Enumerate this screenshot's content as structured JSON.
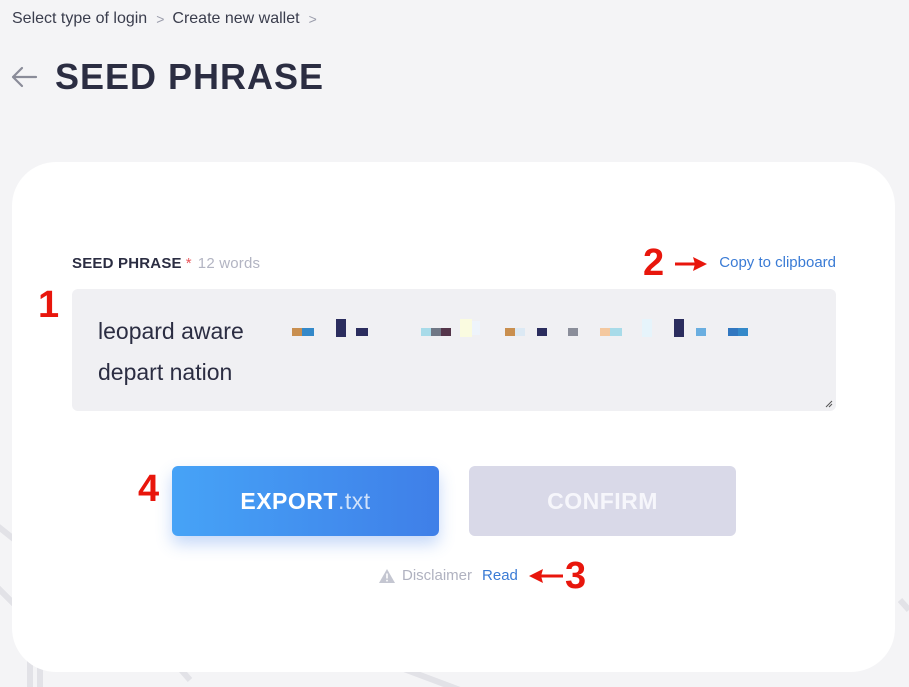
{
  "breadcrumb": {
    "items": [
      "Select type of login",
      "Create new wallet"
    ],
    "separator": ">"
  },
  "header": {
    "title": "SEED PHRASE",
    "back_icon": "arrow-left-icon"
  },
  "seed_field": {
    "label": "SEED PHRASE",
    "required_mark": "*",
    "word_count": "12 words",
    "copy_label": "Copy to clipboard",
    "line1": "leopard aware",
    "line2": "depart nation"
  },
  "buttons": {
    "export_main": "EXPORT",
    "export_ext": ".txt",
    "confirm": "CONFIRM"
  },
  "disclaimer": {
    "label": "Disclaimer",
    "read": "Read",
    "icon": "warning-icon"
  },
  "annotations": [
    "1",
    "2",
    "3",
    "4"
  ],
  "colors": {
    "accent_blue": "#3a7bd5",
    "annotation_red": "#e8160c",
    "title": "#2b2d42",
    "confirm_disabled": "#d9d9e8"
  }
}
